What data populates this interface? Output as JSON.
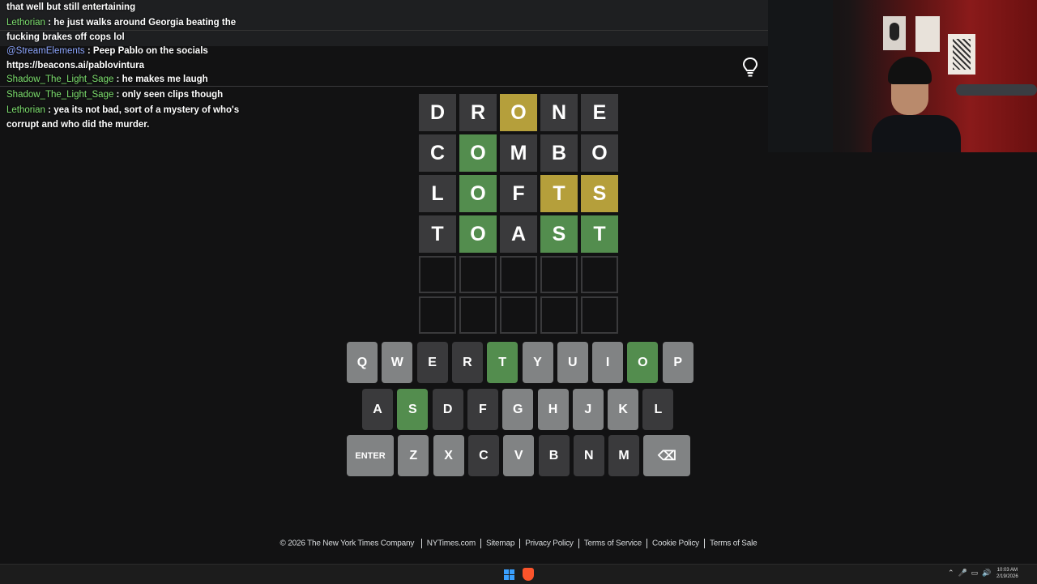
{
  "chat": {
    "messages": [
      {
        "user": "",
        "text": "that well but still entertaining"
      },
      {
        "user": "Lethorian",
        "text": "he just walks around Georgia beating the fucking brakes off cops lol"
      },
      {
        "user": "@StreamElements",
        "text": "Peep Pablo on the socials https://beacons.ai/pablovintura"
      },
      {
        "user": "Shadow_The_Light_Sage",
        "text": "he makes me laugh"
      },
      {
        "user": "Shadow_The_Light_Sage",
        "text": "only seen clips though"
      },
      {
        "user": "Lethorian",
        "text": "yea its not bad, sort of a mystery of who's corrupt and who did the murder."
      }
    ]
  },
  "board": {
    "rows": [
      {
        "letters": [
          "D",
          "R",
          "O",
          "N",
          "E"
        ],
        "states": [
          "absent",
          "absent",
          "present",
          "absent",
          "absent"
        ]
      },
      {
        "letters": [
          "C",
          "O",
          "M",
          "B",
          "O"
        ],
        "states": [
          "absent",
          "correct",
          "absent",
          "absent",
          "absent"
        ]
      },
      {
        "letters": [
          "L",
          "O",
          "F",
          "T",
          "S"
        ],
        "states": [
          "absent",
          "correct",
          "absent",
          "present",
          "present"
        ]
      },
      {
        "letters": [
          "T",
          "O",
          "A",
          "S",
          "T"
        ],
        "states": [
          "absent",
          "correct",
          "absent",
          "correct",
          "correct"
        ]
      },
      {
        "letters": [
          "",
          "",
          "",
          "",
          ""
        ],
        "states": [
          "empty",
          "empty",
          "empty",
          "empty",
          "empty"
        ]
      },
      {
        "letters": [
          "",
          "",
          "",
          "",
          ""
        ],
        "states": [
          "empty",
          "empty",
          "empty",
          "empty",
          "empty"
        ]
      }
    ]
  },
  "keyboard": {
    "rows": [
      [
        {
          "label": "Q",
          "state": "unused"
        },
        {
          "label": "W",
          "state": "unused"
        },
        {
          "label": "E",
          "state": "absent"
        },
        {
          "label": "R",
          "state": "absent"
        },
        {
          "label": "T",
          "state": "correct"
        },
        {
          "label": "Y",
          "state": "unused"
        },
        {
          "label": "U",
          "state": "unused"
        },
        {
          "label": "I",
          "state": "unused"
        },
        {
          "label": "O",
          "state": "correct"
        },
        {
          "label": "P",
          "state": "unused"
        }
      ],
      [
        {
          "label": "A",
          "state": "absent"
        },
        {
          "label": "S",
          "state": "correct"
        },
        {
          "label": "D",
          "state": "absent"
        },
        {
          "label": "F",
          "state": "absent"
        },
        {
          "label": "G",
          "state": "unused"
        },
        {
          "label": "H",
          "state": "unused"
        },
        {
          "label": "J",
          "state": "unused"
        },
        {
          "label": "K",
          "state": "unused"
        },
        {
          "label": "L",
          "state": "absent"
        }
      ],
      [
        {
          "label": "ENTER",
          "state": "unused",
          "wide": true
        },
        {
          "label": "Z",
          "state": "unused"
        },
        {
          "label": "X",
          "state": "unused"
        },
        {
          "label": "C",
          "state": "absent"
        },
        {
          "label": "V",
          "state": "unused"
        },
        {
          "label": "B",
          "state": "absent"
        },
        {
          "label": "N",
          "state": "absent"
        },
        {
          "label": "M",
          "state": "absent"
        },
        {
          "label": "⌫",
          "state": "unused",
          "wide": true,
          "icon": "backspace-icon"
        }
      ]
    ]
  },
  "footer": {
    "copyright": "© 2026 The New York Times Company",
    "links": [
      "NYTimes.com",
      "Sitemap",
      "Privacy Policy",
      "Terms of Service",
      "Cookie Policy",
      "Terms of Sale"
    ]
  },
  "taskbar": {
    "time": "10:03 AM",
    "date": "2/19/2026"
  },
  "colors": {
    "correct": "#538d4e",
    "present": "#b59f3b",
    "absent": "#3a3a3c",
    "unused": "#818384",
    "background": "#121213"
  }
}
